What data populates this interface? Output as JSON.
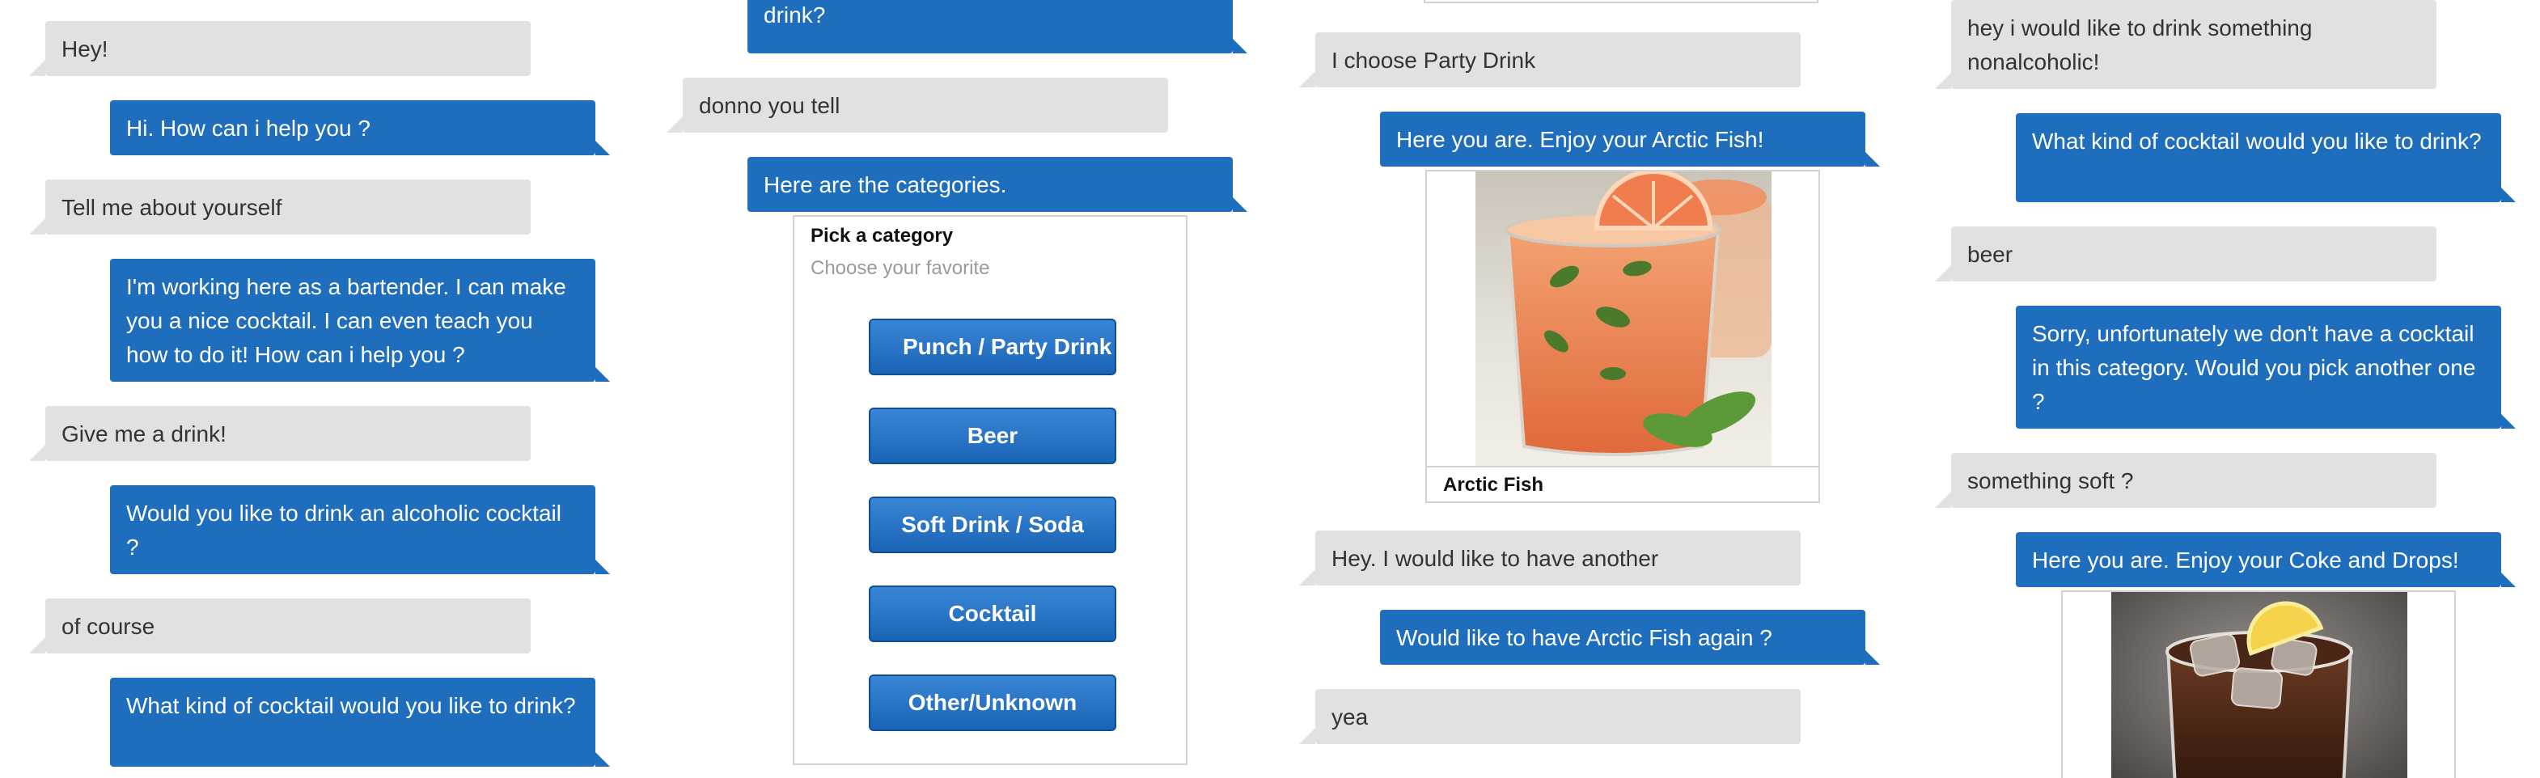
{
  "colors": {
    "user_bubble": "#e1e1e1",
    "bot_bubble": "#1f6ebe",
    "button": "#1f6ebe"
  },
  "col1": {
    "messages": [
      "Hey!",
      "Hi. How can i help you ?",
      "Tell me about yourself",
      "I'm working here as a bartender. I can make you a nice cocktail. I can even teach you how to do it! How can i help you ?",
      "Give me a drink!",
      "Would you like to drink an alcoholic cocktail ?",
      "of course",
      "What kind of cocktail would you like to drink?"
    ]
  },
  "col2": {
    "messages": [
      "drink?",
      "donno you tell",
      "Here are the categories."
    ],
    "category_card": {
      "title": "Pick a category",
      "subtitle": "Choose your favorite",
      "buttons": [
        "Punch / Party Drink",
        "Beer",
        "Soft Drink / Soda",
        "Cocktail",
        "Other/Unknown"
      ]
    }
  },
  "col3": {
    "messages": [
      "I choose Party Drink",
      "Here you are. Enjoy your Arctic Fish!",
      "Hey. I would like to have another",
      "Would like to have Arctic Fish again ?",
      "yea"
    ],
    "image_card": {
      "caption": "Arctic Fish",
      "icon": "cocktail-photo-icon"
    }
  },
  "col4": {
    "messages": [
      "hey i would like to drink something nonalcoholic!",
      "What kind of cocktail would you like to drink?",
      "beer",
      "Sorry, unfortunately we don't have a cocktail in this category. Would you pick another one ?",
      "something soft ?",
      "Here you are. Enjoy your Coke and Drops!"
    ],
    "image_card": {
      "icon": "coke-photo-icon"
    }
  }
}
